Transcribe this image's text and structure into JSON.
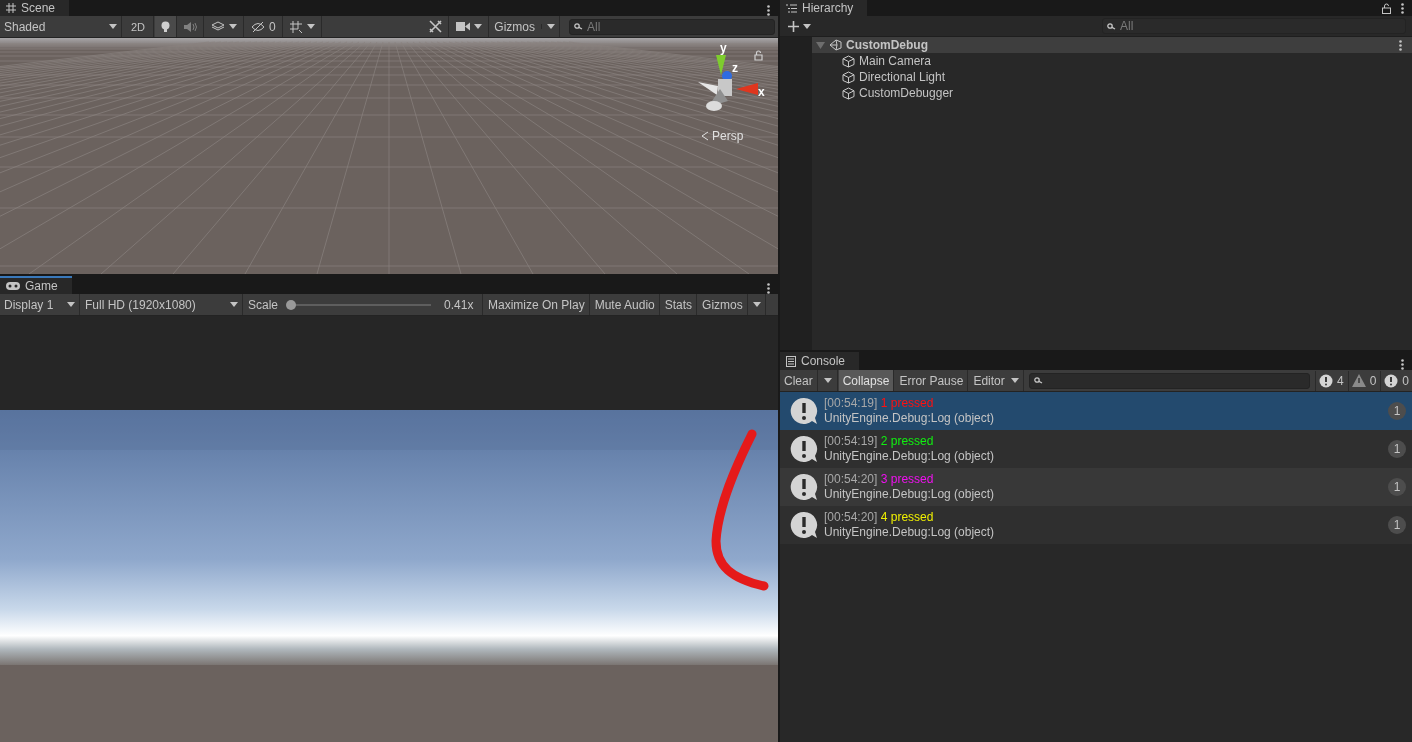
{
  "scene": {
    "tab": "Scene",
    "shading": "Shaded",
    "mode": "2D",
    "hidden_count": "0",
    "gizmos": "Gizmos",
    "search_placeholder": "All",
    "gizmo": {
      "axes": [
        "y",
        "z",
        "x"
      ],
      "projection": "Persp"
    }
  },
  "game": {
    "tab": "Game",
    "display": "Display 1",
    "resolution": "Full HD (1920x1080)",
    "scale_label": "Scale",
    "scale": {
      "level": 0
    },
    "scale_value": "0.41x",
    "buttons": [
      "Maximize On Play",
      "Mute Audio",
      "Stats",
      "Gizmos"
    ]
  },
  "hierarchy": {
    "tab": "Hierarchy",
    "search_placeholder": "All",
    "items": [
      {
        "label": "CustomDebug",
        "kind": "scene",
        "expanded": true,
        "children": [
          {
            "label": "Main Camera",
            "kind": "object"
          },
          {
            "label": "Directional Light",
            "kind": "object"
          },
          {
            "label": "CustomDebugger",
            "kind": "object"
          }
        ]
      }
    ]
  },
  "console": {
    "tab": "Console",
    "buttons": [
      {
        "label": "Clear",
        "selected": false
      },
      {
        "label": "Collapse",
        "selected": true
      },
      {
        "label": "Error Pause",
        "selected": false
      }
    ],
    "editor": "Editor",
    "counts": [
      {
        "kind": "info",
        "count": "4"
      },
      {
        "kind": "warning",
        "count": "0"
      },
      {
        "kind": "error",
        "count": "0"
      }
    ],
    "entries": [
      {
        "time": "[00:54:19]",
        "message": "1 pressed",
        "color": "#ff1010",
        "detail": "UnityEngine.Debug:Log (object)",
        "count": "1",
        "selected": true
      },
      {
        "time": "[00:54:19]",
        "message": "2 pressed",
        "color": "#10f010",
        "detail": "UnityEngine.Debug:Log (object)",
        "count": "1",
        "selected": false
      },
      {
        "time": "[00:54:20]",
        "message": "3 pressed",
        "color": "#f010f0",
        "detail": "UnityEngine.Debug:Log (object)",
        "count": "1",
        "selected": false
      },
      {
        "time": "[00:54:20]",
        "message": "4 pressed",
        "color": "#f0f000",
        "detail": "UnityEngine.Debug:Log (object)",
        "count": "1",
        "selected": false
      }
    ]
  }
}
